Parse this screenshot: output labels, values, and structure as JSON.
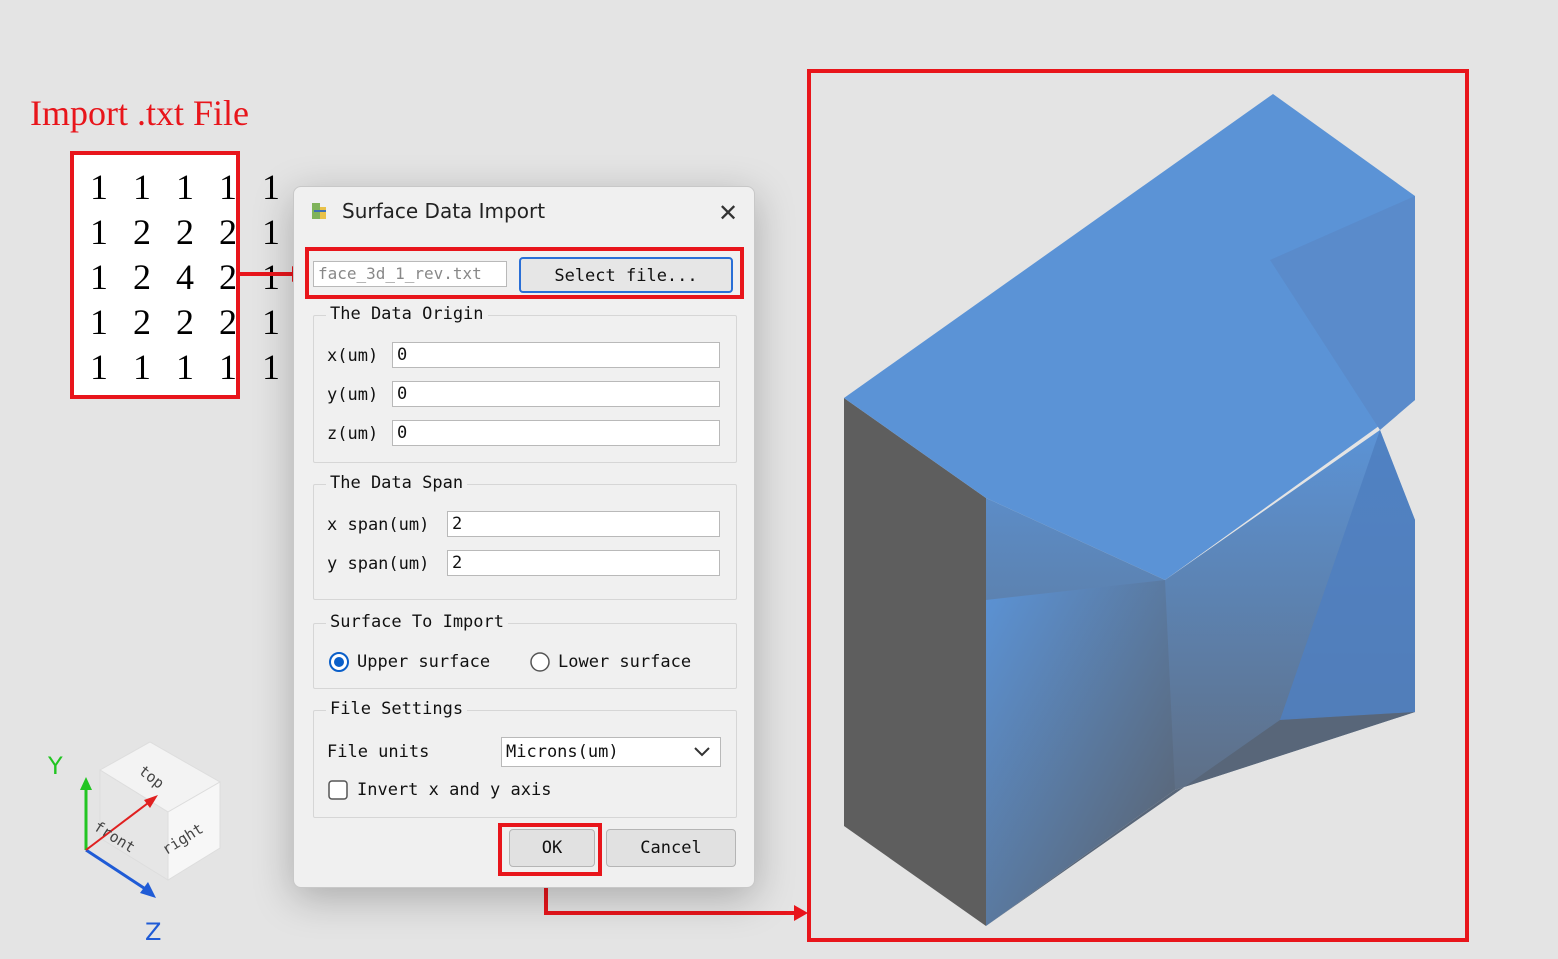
{
  "annotation": {
    "title": "Import .txt File",
    "matrix": [
      "1 1 1 1 1",
      "1 2 2 2 1",
      "1 2 4 2 1",
      "1 2 2 2 1",
      "1 1 1 1 1"
    ]
  },
  "dialog": {
    "title": "Surface Data Import",
    "file_name": "face_3d_1_rev.txt",
    "select_file_label": "Select file...",
    "origin": {
      "title": "The Data Origin",
      "x_label": "x(um)",
      "x_value": "0",
      "y_label": "y(um)",
      "y_value": "0",
      "z_label": "z(um)",
      "z_value": "0"
    },
    "span": {
      "title": "The Data Span",
      "x_label": "x span(um)",
      "x_value": "2",
      "y_label": "y span(um)",
      "y_value": "2"
    },
    "surface": {
      "title": "Surface To Import",
      "upper_label": "Upper surface",
      "lower_label": "Lower surface",
      "selected": "upper"
    },
    "file_settings": {
      "title": "File Settings",
      "units_label": "File units",
      "units_value": "Microns(um)",
      "invert_label": "Invert x and y axis",
      "invert_checked": false
    },
    "ok_label": "OK",
    "cancel_label": "Cancel"
  },
  "gizmo": {
    "y_label": "Y",
    "z_label": "Z",
    "top_label": "top",
    "front_label": "front",
    "right_label": "right"
  },
  "colors": {
    "annotation_red": "#e8151b",
    "surface_blue": "#5b93d6",
    "side_gray": "#5e5e5e",
    "y_axis_green": "#22c522",
    "z_axis_blue": "#1f5bd6",
    "x_axis_red": "#e02020"
  }
}
